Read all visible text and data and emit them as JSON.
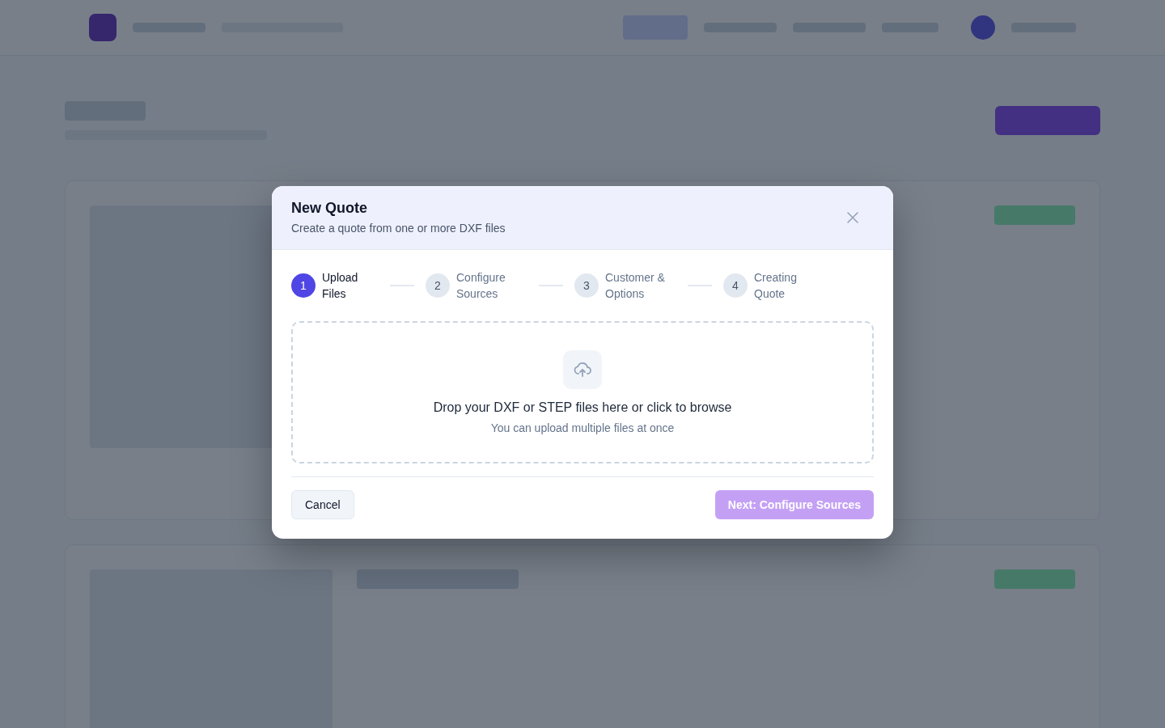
{
  "dialog": {
    "title": "New Quote",
    "subtitle": "Create a quote from one or more DXF files",
    "steps": [
      {
        "number": "1",
        "label": "Upload Files",
        "selected": true
      },
      {
        "number": "2",
        "label": "Configure Sources",
        "selected": false
      },
      {
        "number": "3",
        "label": "Customer & Options",
        "selected": false
      },
      {
        "number": "4",
        "label": "Creating Quote",
        "selected": false
      }
    ],
    "dropzone": {
      "title": "Drop your DXF or STEP files here or click to browse",
      "hint": "You can upload multiple files at once"
    },
    "cancel": "Cancel",
    "next": {
      "label": "Next: Configure Sources",
      "disabled": true
    }
  }
}
